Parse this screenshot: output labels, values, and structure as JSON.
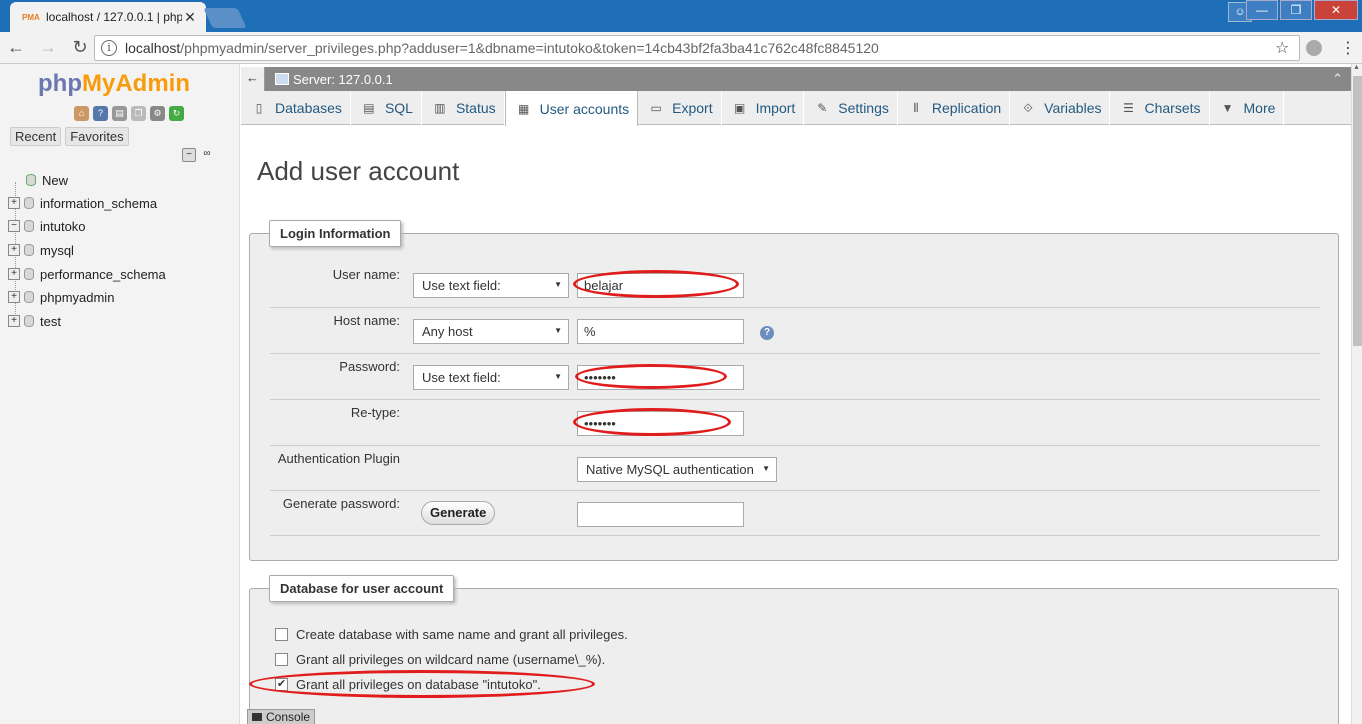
{
  "browser": {
    "tab_title": "localhost / 127.0.0.1 | php",
    "url_host": "localhost",
    "url_path": "/phpmyadmin/server_privileges.php?adduser=1&dbname=intutoko&token=14cb43bf2fa3ba41c762c48fc8845120"
  },
  "sidebar": {
    "logo_php": "php",
    "logo_myadmin": "MyAdmin",
    "recent_label": "Recent",
    "favorites_label": "Favorites",
    "new_label": "New",
    "databases": [
      "information_schema",
      "intutoko",
      "mysql",
      "performance_schema",
      "phpmyadmin",
      "test"
    ]
  },
  "breadcrumb": {
    "server": "Server: 127.0.0.1"
  },
  "menu": {
    "tabs": [
      "Databases",
      "SQL",
      "Status",
      "User accounts",
      "Export",
      "Import",
      "Settings",
      "Replication",
      "Variables",
      "Charsets",
      "More"
    ],
    "active": "User accounts"
  },
  "page": {
    "title": "Add user account"
  },
  "login": {
    "legend": "Login Information",
    "username_label": "User name:",
    "username_mode": "Use text field:",
    "username_value": "belajar",
    "host_label": "Host name:",
    "host_mode": "Any host",
    "host_value": "%",
    "password_label": "Password:",
    "password_mode": "Use text field:",
    "password_value": "•••••••",
    "retype_label": "Re-type:",
    "retype_value": "•••••••",
    "auth_label": "Authentication Plugin",
    "auth_value": "Native MySQL authentication",
    "generate_label": "Generate password:",
    "generate_button": "Generate",
    "generate_value": ""
  },
  "database": {
    "legend": "Database for user account",
    "options": [
      {
        "label": "Create database with same name and grant all privileges.",
        "checked": false
      },
      {
        "label": "Grant all privileges on wildcard name (username\\_%).",
        "checked": false
      },
      {
        "label": "Grant all privileges on database \"intutoko\".",
        "checked": true
      }
    ]
  },
  "console": {
    "label": "Console"
  },
  "colors": {
    "annotation": "#e01c1c",
    "link": "#235a81",
    "chrome": "#1e6fb8"
  }
}
